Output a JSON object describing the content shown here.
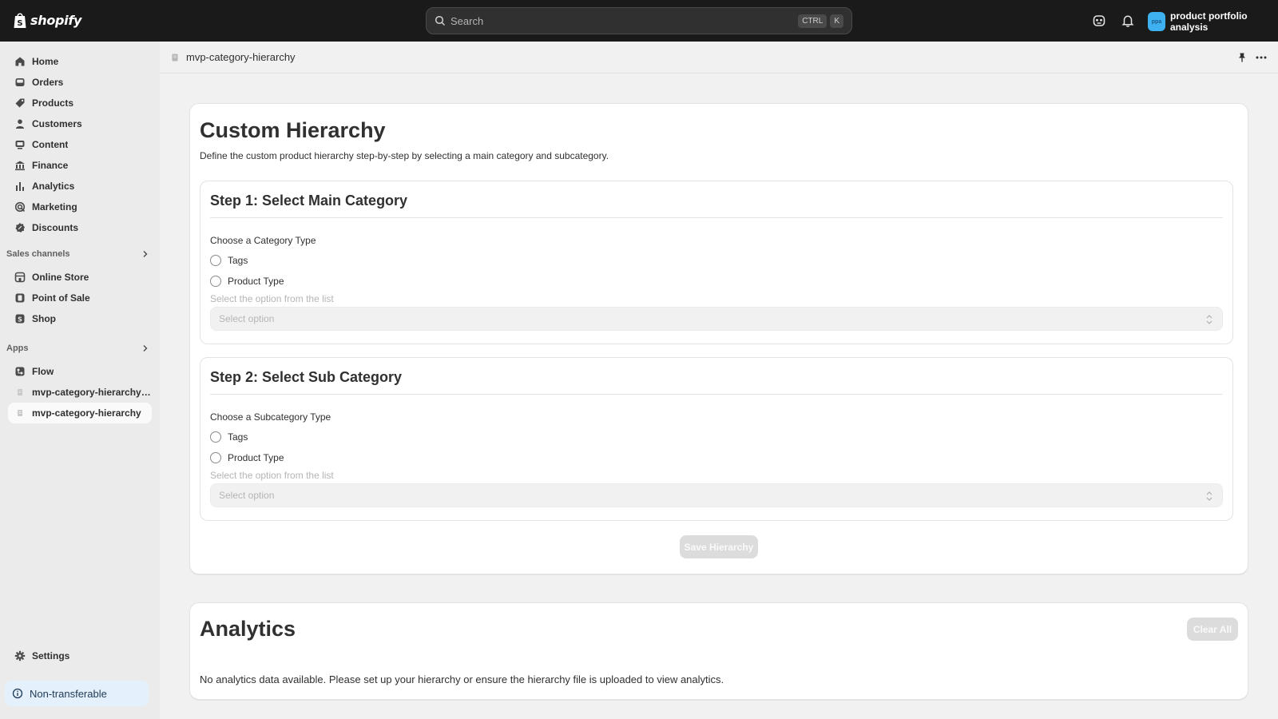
{
  "topbar": {
    "brand": "shopify",
    "search_placeholder": "Search",
    "shortcut_ctrl": "CTRL",
    "shortcut_key": "K",
    "account_initials": "ppa",
    "account_name": "product portfolio analysis"
  },
  "sidebar": {
    "items": [
      {
        "label": "Home",
        "icon": "home-icon"
      },
      {
        "label": "Orders",
        "icon": "inbox-icon"
      },
      {
        "label": "Products",
        "icon": "tag-icon"
      },
      {
        "label": "Customers",
        "icon": "person-icon"
      },
      {
        "label": "Content",
        "icon": "image-icon"
      },
      {
        "label": "Finance",
        "icon": "bank-icon"
      },
      {
        "label": "Analytics",
        "icon": "bar-chart-icon"
      },
      {
        "label": "Marketing",
        "icon": "target-icon"
      },
      {
        "label": "Discounts",
        "icon": "discount-icon"
      }
    ],
    "sales_channels_label": "Sales channels",
    "sales_channels": [
      {
        "label": "Online Store",
        "icon": "store-icon"
      },
      {
        "label": "Point of Sale",
        "icon": "pos-icon"
      },
      {
        "label": "Shop",
        "icon": "shop-icon"
      }
    ],
    "apps_label": "Apps",
    "apps": [
      {
        "label": "Flow",
        "icon": "flow-icon"
      },
      {
        "label": "mvp-category-hierarchy-l...",
        "icon": "app-icon"
      },
      {
        "label": "mvp-category-hierarchy",
        "icon": "app-icon",
        "active": true
      }
    ],
    "settings_label": "Settings",
    "non_transferable_label": "Non-transferable"
  },
  "page": {
    "title": "mvp-category-hierarchy"
  },
  "hierarchy": {
    "title": "Custom Hierarchy",
    "description": "Define the custom product hierarchy step-by-step by selecting a main category and subcategory.",
    "step1": {
      "title": "Step 1: Select Main Category",
      "choose_label": "Choose a Category Type",
      "option_tags": "Tags",
      "option_product_type": "Product Type",
      "hint": "Select the option from the list",
      "select_placeholder": "Select option"
    },
    "step2": {
      "title": "Step 2: Select Sub Category",
      "choose_label": "Choose a Subcategory Type",
      "option_tags": "Tags",
      "option_product_type": "Product Type",
      "hint": "Select the option from the list",
      "select_placeholder": "Select option"
    },
    "save_label": "Save Hierarchy"
  },
  "analytics": {
    "title": "Analytics",
    "clear_label": "Clear All",
    "empty_message": "No analytics data available. Please set up your hierarchy or ensure the hierarchy file is uploaded to view analytics."
  },
  "colors": {
    "topbar": "#1a1a1a",
    "sidebar": "#ebebeb",
    "avatar": "#3eb2f0",
    "notice": "#e4f0fb"
  }
}
